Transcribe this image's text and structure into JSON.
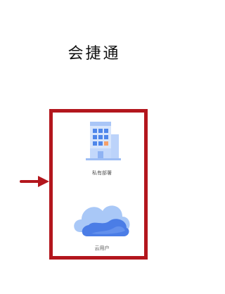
{
  "app": {
    "title": "会捷通"
  },
  "options": [
    {
      "label": "私有部署",
      "icon": "building-icon"
    },
    {
      "label": "云用户",
      "icon": "cloud-icon"
    }
  ],
  "colors": {
    "highlight_border": "#b3161d",
    "arrow": "#b3161d",
    "building_blue": "#4e86ea",
    "building_light": "#bcd3fa",
    "window_accent": "#f5a06a",
    "cloud_light": "#a9c8f7",
    "cloud_dark": "#4b7de6"
  }
}
